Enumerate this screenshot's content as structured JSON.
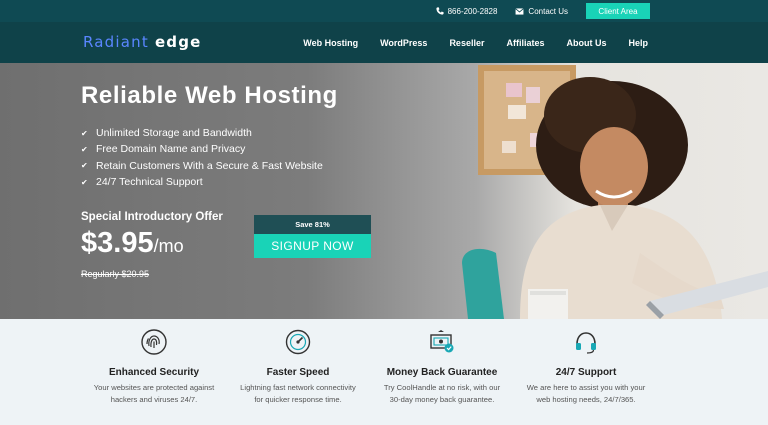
{
  "topbar": {
    "phone": "866-200-2828",
    "contact": "Contact Us",
    "client_area": "Client Area",
    "icons": [
      "phone-icon",
      "envelope-icon"
    ]
  },
  "nav": {
    "logo_part1": "Radiant",
    "logo_part2": "edge",
    "items": [
      "Web Hosting",
      "WordPress",
      "Reseller",
      "Affiliates",
      "About Us",
      "Help"
    ]
  },
  "hero": {
    "title": "Reliable Web Hosting",
    "features": [
      "Unlimited Storage and Bandwidth",
      "Free Domain Name and Privacy",
      "Retain Customers With a Secure & Fast Website",
      "24/7 Technical Support"
    ],
    "offer_label": "Special Introductory Offer",
    "price": "$3.95",
    "per": "/mo",
    "regular": "Regularly $20.95",
    "save": "Save 81%",
    "signup": "SIGNUP NOW"
  },
  "features": [
    {
      "icon": "fingerprint-icon",
      "title": "Enhanced Security",
      "line1": "Your websites are protected against",
      "line2": "hackers and viruses 24/7."
    },
    {
      "icon": "speedometer-icon",
      "title": "Faster Speed",
      "line1": "Lightning fast network connectivity",
      "line2": "for quicker response time."
    },
    {
      "icon": "money-back-icon",
      "title": "Money Back Guarantee",
      "line1": "Try CoolHandle at no risk, with our",
      "line2": "30-day money back guarantee."
    },
    {
      "icon": "headset-icon",
      "title": "24/7 Support",
      "line1": "We are here to assist you with your",
      "line2": "web hosting needs, 24/7/365."
    }
  ],
  "colors": {
    "topbar": "#0f4a53",
    "nav": "#0f4249",
    "accent": "#19d3b7",
    "logo_blue": "#5a86ff"
  }
}
